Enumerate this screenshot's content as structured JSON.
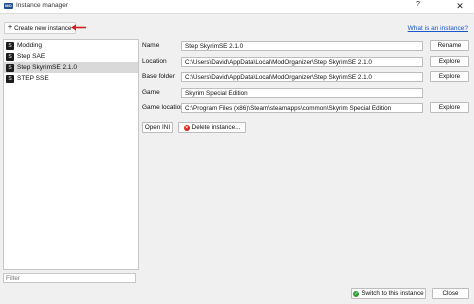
{
  "window": {
    "title": "Instance manager",
    "help_glyph": "?",
    "close_glyph": "✕",
    "app_icon_text": "MO"
  },
  "toolbar": {
    "create_label": "Create new instance",
    "create_icon": "plus-icon",
    "what_link": "What is an instance?"
  },
  "instances": {
    "icon_text": "S",
    "items": [
      {
        "label": "Modding",
        "selected": false
      },
      {
        "label": "Step SAE",
        "selected": false
      },
      {
        "label": "Step SkyrimSE 2.1.0",
        "selected": true
      },
      {
        "label": "STEP SSE",
        "selected": false
      }
    ]
  },
  "filter": {
    "placeholder": "Filter"
  },
  "details": {
    "name_label": "Name",
    "name_value": "Step SkyrimSE 2.1.0",
    "rename_label": "Rename",
    "location_label": "Location",
    "location_value": "C:\\Users\\David\\AppData\\Local\\ModOrganizer\\Step SkyrimSE 2.1.0",
    "explore_label": "Explore",
    "base_label": "Base folder",
    "base_value": "C:\\Users\\David\\AppData\\Local\\ModOrganizer\\Step SkyrimSE 2.1.0",
    "game_label": "Game",
    "game_value": "Skyrim Special Edition",
    "game_location_label": "Game location",
    "game_location_value": "C:\\Program Files (x86)\\Steam\\steamapps\\common\\Skyrim Special Edition"
  },
  "actions": {
    "open_ini": "Open INI",
    "delete": "Delete instance...",
    "switch": "Switch to this instance",
    "close": "Close"
  },
  "colors": {
    "accent_link": "#1a57c8",
    "arrow": "#d21f1f",
    "delete_icon": "#d42a1b",
    "check_icon": "#2f9a35",
    "selected_row": "#d9d9d9"
  }
}
